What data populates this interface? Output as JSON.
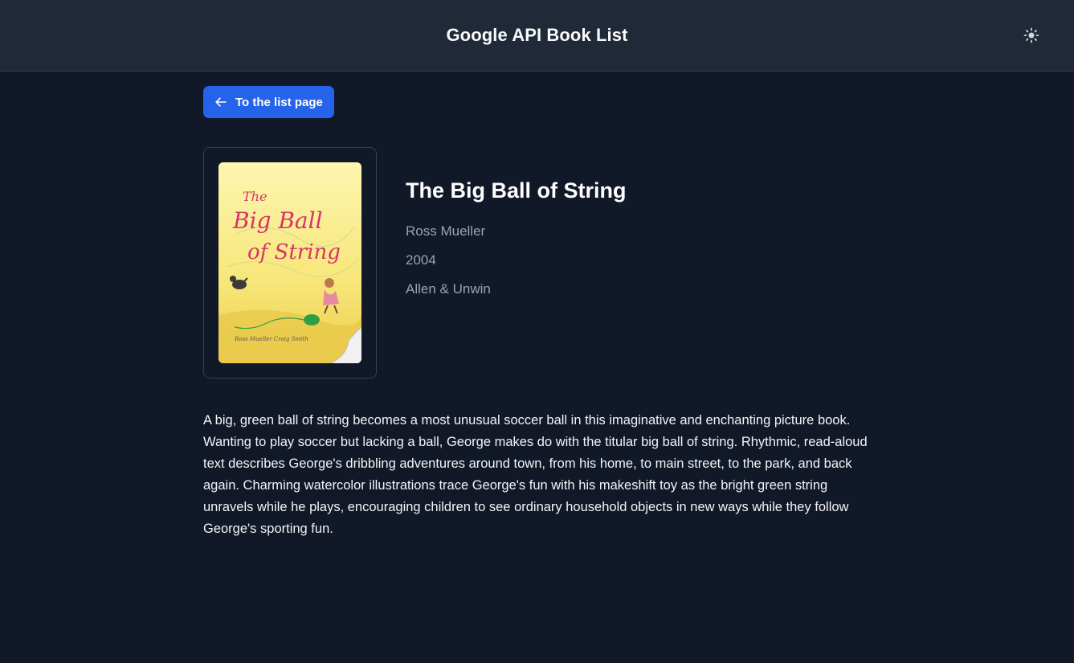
{
  "header": {
    "title": "Google API Book List",
    "theme_toggle_icon": "sun-icon"
  },
  "back_button": {
    "label": "To the list page",
    "icon": "arrow-left-icon"
  },
  "book": {
    "title": "The Big Ball of String",
    "author": "Ross Mueller",
    "year": "2004",
    "publisher": "Allen & Unwin",
    "description": "A big, green ball of string becomes a most unusual soccer ball in this imaginative and enchanting picture book. Wanting to play soccer but lacking a ball, George makes do with the titular big ball of string. Rhythmic, read-aloud text describes George's dribbling adventures around town, from his home, to main street, to the park, and back again. Charming watercolor illustrations trace George's fun with his makeshift toy as the bright green string unravels while he plays, encouraging children to see ordinary household objects in new ways while they follow George's sporting fun.",
    "cover": {
      "title_line1": "The",
      "title_line2": "Big Ball",
      "title_line3": "of String",
      "credits": "Ross Mueller   Craig Smith"
    }
  },
  "colors": {
    "background": "#111827",
    "header": "#1f2937",
    "accent": "#2563eb",
    "muted_text": "#9ca3af"
  }
}
